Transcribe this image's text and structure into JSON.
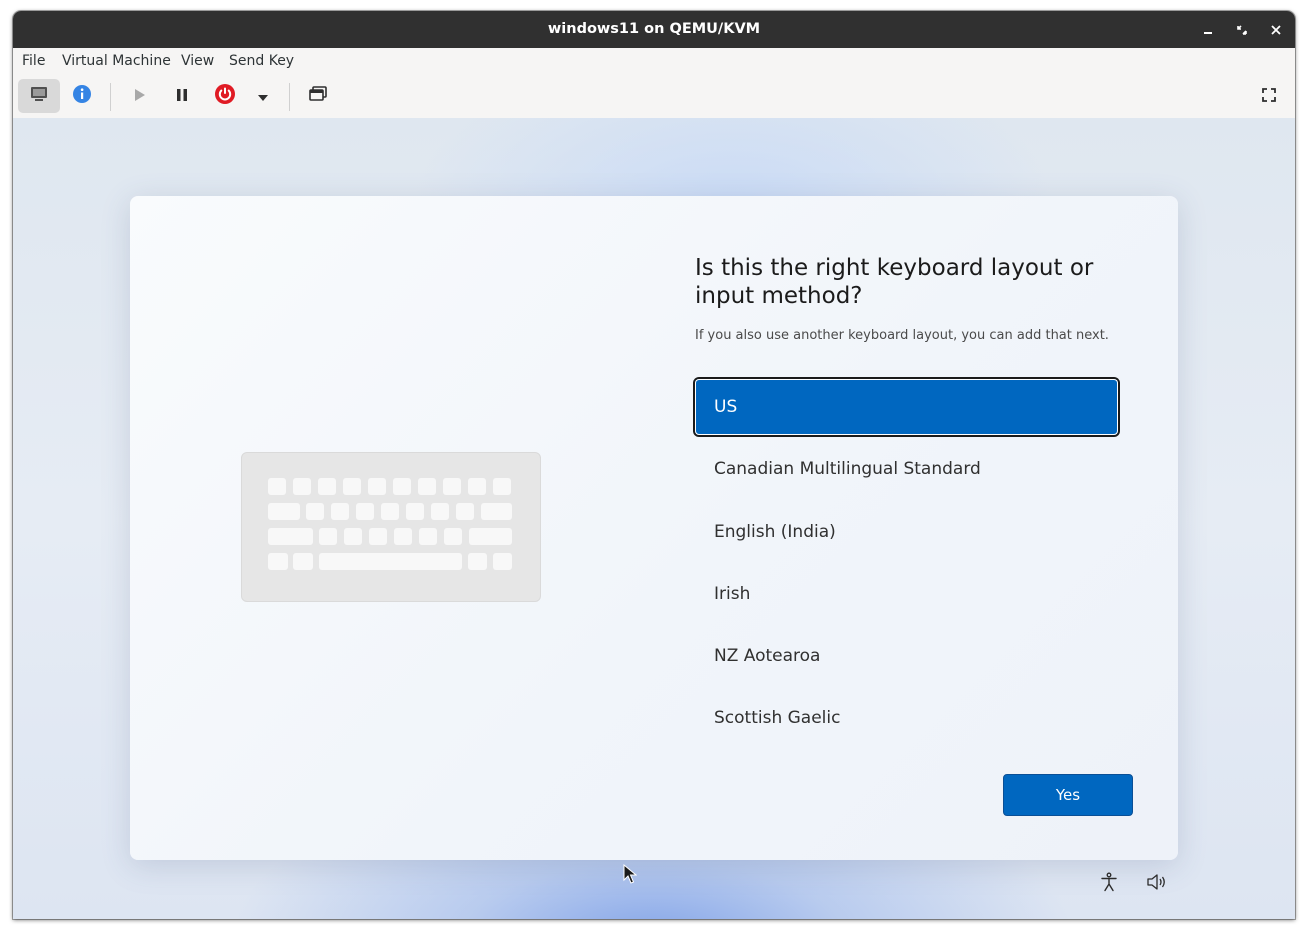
{
  "window": {
    "title": "windows11 on QEMU/KVM"
  },
  "menubar": {
    "items": [
      "File",
      "Virtual Machine",
      "View",
      "Send Key"
    ]
  },
  "toolbar": {
    "buttons": [
      {
        "icon": "console-icon",
        "active": true
      },
      {
        "icon": "info-icon"
      },
      {
        "icon": "run-icon"
      },
      {
        "icon": "pause-icon"
      },
      {
        "icon": "power-icon"
      },
      {
        "icon": "dropdown-arrow-icon"
      },
      {
        "icon": "snapshots-icon"
      },
      {
        "icon": "fullscreen-icon"
      }
    ]
  },
  "setup": {
    "heading": "Is this the right keyboard layout or input method?",
    "subtext": "If you also use another keyboard layout, you can add that next.",
    "layouts": [
      {
        "label": "US",
        "selected": true
      },
      {
        "label": "Canadian Multilingual Standard"
      },
      {
        "label": "English (India)"
      },
      {
        "label": "Irish"
      },
      {
        "label": "NZ Aotearoa"
      },
      {
        "label": "Scottish Gaelic"
      }
    ],
    "yes_label": "Yes"
  },
  "colors": {
    "accent": "#0067c0",
    "titlebar": "#303030",
    "power": "#e01b24",
    "info": "#3584e4"
  }
}
